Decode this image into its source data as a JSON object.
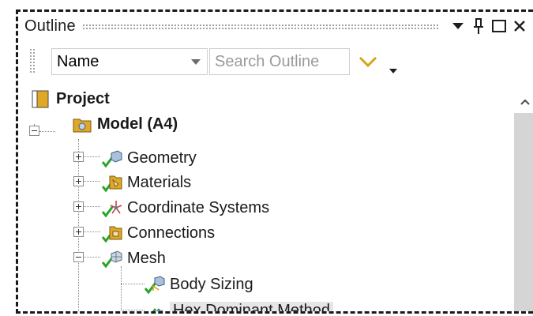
{
  "outline": {
    "title": "Outline",
    "buttons": {
      "menu": "▾",
      "pin": "⊥",
      "maximize": "☐",
      "close": "✕"
    }
  },
  "toolbar": {
    "name_combo": "Name",
    "search_placeholder": "Search Outline"
  },
  "tree": {
    "project": "Project",
    "model": "Model (A4)",
    "geometry": "Geometry",
    "materials": "Materials",
    "coordinate_systems": "Coordinate Systems",
    "connections": "Connections",
    "mesh": "Mesh",
    "body_sizing": "Body Sizing",
    "hex_dominant": "Hex Dominant Method"
  },
  "colors": {
    "folder": "#e0a826",
    "check": "#2aa52a",
    "accent_chevron": "#d9a21b",
    "selection": "#e6e6e6",
    "scrollbar": "#d5d5d5"
  }
}
